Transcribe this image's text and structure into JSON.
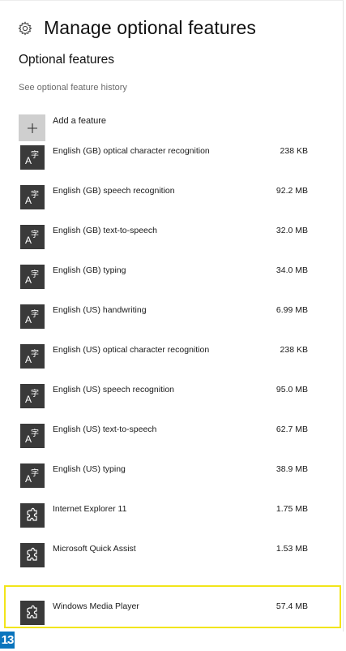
{
  "header": {
    "title": "Manage optional features",
    "icon": "gear-icon"
  },
  "section": {
    "title": "Optional features",
    "history_link": "See optional feature history"
  },
  "add_feature": {
    "label": "Add a feature",
    "icon": "plus-icon"
  },
  "features": [
    {
      "name": "English (GB) optical character recognition",
      "size": "238 KB",
      "icon": "language-icon"
    },
    {
      "name": "English (GB) speech recognition",
      "size": "92.2 MB",
      "icon": "language-icon"
    },
    {
      "name": "English (GB) text-to-speech",
      "size": "32.0 MB",
      "icon": "language-icon"
    },
    {
      "name": "English (GB) typing",
      "size": "34.0 MB",
      "icon": "language-icon"
    },
    {
      "name": "English (US) handwriting",
      "size": "6.99 MB",
      "icon": "language-icon"
    },
    {
      "name": "English (US) optical character recognition",
      "size": "238 KB",
      "icon": "language-icon"
    },
    {
      "name": "English (US) speech recognition",
      "size": "95.0 MB",
      "icon": "language-icon"
    },
    {
      "name": "English (US) text-to-speech",
      "size": "62.7 MB",
      "icon": "language-icon"
    },
    {
      "name": "English (US) typing",
      "size": "38.9 MB",
      "icon": "language-icon"
    },
    {
      "name": "Internet Explorer 11",
      "size": "1.75 MB",
      "icon": "puzzle-icon"
    },
    {
      "name": "Microsoft Quick Assist",
      "size": "1.53 MB",
      "icon": "puzzle-icon"
    },
    {
      "name": "Windows Media Player",
      "size": "57.4 MB",
      "icon": "puzzle-icon"
    }
  ],
  "highlight_color": "#f2e51a",
  "step_badge": {
    "label": "13",
    "color": "#0a74bd"
  }
}
